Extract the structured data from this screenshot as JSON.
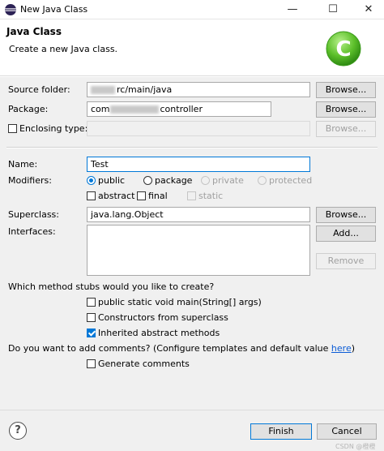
{
  "window": {
    "title": "New Java Class",
    "minimize_glyph": "—",
    "maximize_glyph": "☐",
    "close_glyph": "✕"
  },
  "banner": {
    "title": "Java Class",
    "subtitle": "Create a new Java class.",
    "logo_letter": "C"
  },
  "form": {
    "source_folder": {
      "label": "Source folder:",
      "value": "rc/main/java",
      "button": "Browse..."
    },
    "package": {
      "label": "Package:",
      "value_prefix": "com",
      "value_suffix": "controller",
      "button": "Browse..."
    },
    "enclosing_type": {
      "label": "Enclosing type:",
      "checked": false,
      "button": "Browse..."
    },
    "name": {
      "label": "Name:",
      "value": "Test"
    },
    "modifiers": {
      "label": "Modifiers:",
      "access": [
        "public",
        "package",
        "private",
        "protected"
      ],
      "selected_access": "public",
      "options": [
        "abstract",
        "final",
        "static"
      ]
    },
    "superclass": {
      "label": "Superclass:",
      "value": "java.lang.Object",
      "button": "Browse..."
    },
    "interfaces": {
      "label": "Interfaces:",
      "add_button": "Add...",
      "remove_button": "Remove"
    },
    "stubs": {
      "question": "Which method stubs would you like to create?",
      "main": "public static void main(String[] args)",
      "constructors": "Constructors from superclass",
      "inherited": "Inherited abstract methods"
    },
    "comments": {
      "question": "Do you want to add comments? (Configure templates and default value ",
      "link": "here",
      "question_end": ")",
      "generate": "Generate comments"
    }
  },
  "footer": {
    "help_glyph": "?",
    "finish": "Finish",
    "cancel": "Cancel",
    "watermark": "CSDN @橙橙"
  },
  "colors": {
    "accent": "#0078d7",
    "logo_green": "#5cbf2a",
    "link": "#0b5cd6"
  }
}
